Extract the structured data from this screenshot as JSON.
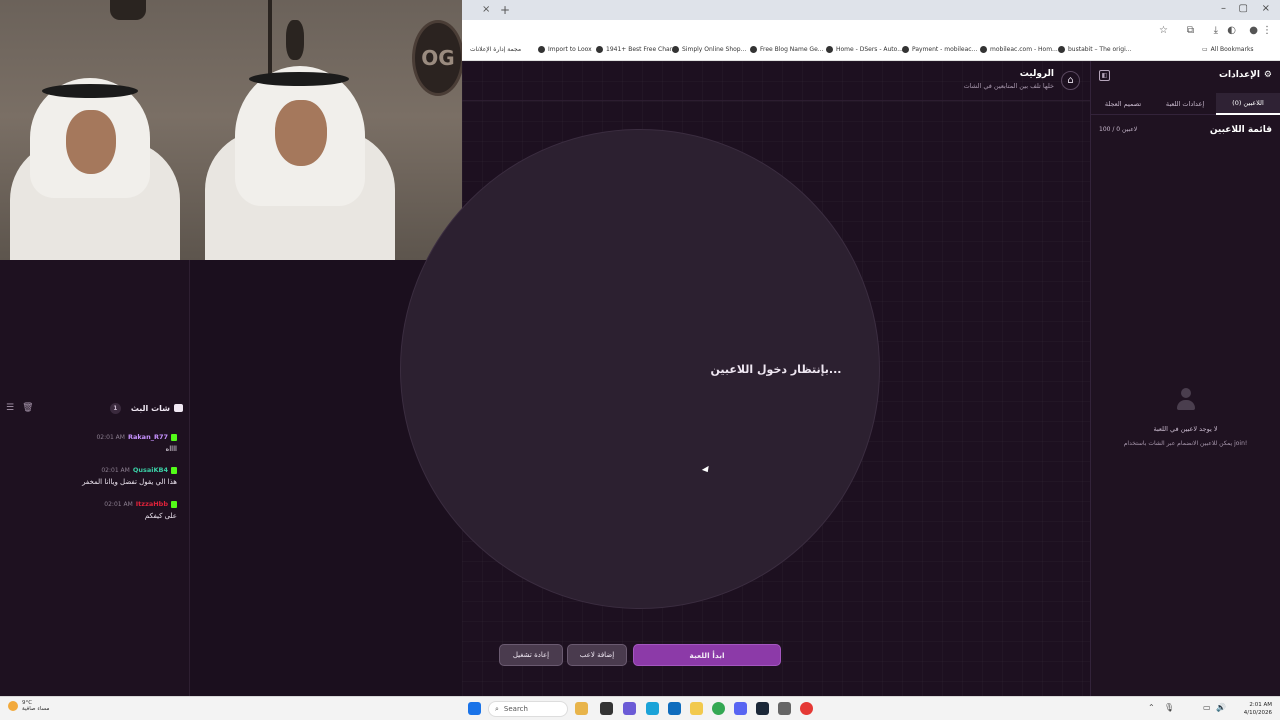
{
  "browser": {
    "tab_close": "×",
    "tab_new": "+",
    "window_controls": [
      "–",
      "▢",
      "×"
    ],
    "bookmarks": [
      "مجمة إدارة الإعلانات",
      "Import to Loox",
      "1941+ Best Free Char...",
      "Simply Online Shop...",
      "Free Blog Name Ge...",
      "Home - DSers - Auto...",
      "Payment - mobileac...",
      "mobileac.com - Hom...",
      "bustabit – The origi..."
    ],
    "all_bookmarks": "All Bookmarks"
  },
  "game": {
    "title": "الروليت",
    "subtitle": "خلها تلف بين المتابعين في الشات",
    "waiting_text": "بإنتظار دخول اللاعبين...",
    "buttons": {
      "restart": "إعادة تشغيل",
      "add_player": "إضافة لاعب",
      "start": "ابدأ اللعبة"
    }
  },
  "settings": {
    "title": "الإعدادات",
    "tabs": [
      "اللاعبين (0)",
      "إعدادات اللعبة",
      "تصميم العجلة"
    ],
    "active_tab_index": 0,
    "list_title": "قائمة اللاعبين",
    "player_count": "100 / 0 لاعبين",
    "empty_title": "لا يوجد لاعبين في اللعبة",
    "empty_subtitle": "يمكن للاعبين الانضمام عبر الشات باستخدام join!"
  },
  "chat": {
    "title": "شات البث",
    "count": "1",
    "messages": [
      {
        "time": "02:01 AM",
        "user": "Rakan_R77",
        "user_color": "#c792ff",
        "text": "ااااه"
      },
      {
        "time": "02:01 AM",
        "user": "QusaiKB4",
        "user_color": "#3ad0a6",
        "text": "هذا الي يقول تفضل وياانا المخفر"
      },
      {
        "time": "02:01 AM",
        "user": "ItzzaHbb",
        "user_color": "#e0223a",
        "text": "على كيفكم"
      }
    ]
  },
  "taskbar": {
    "weather_temp": "9°C",
    "weather_desc": "مساء صافية",
    "search_label": "Search",
    "time": "2:01 AM",
    "date": "4/10/2026"
  },
  "colors": {
    "accent": "#8c3aa8",
    "kick_green": "#53fc18",
    "background": "#1b0f1e"
  }
}
